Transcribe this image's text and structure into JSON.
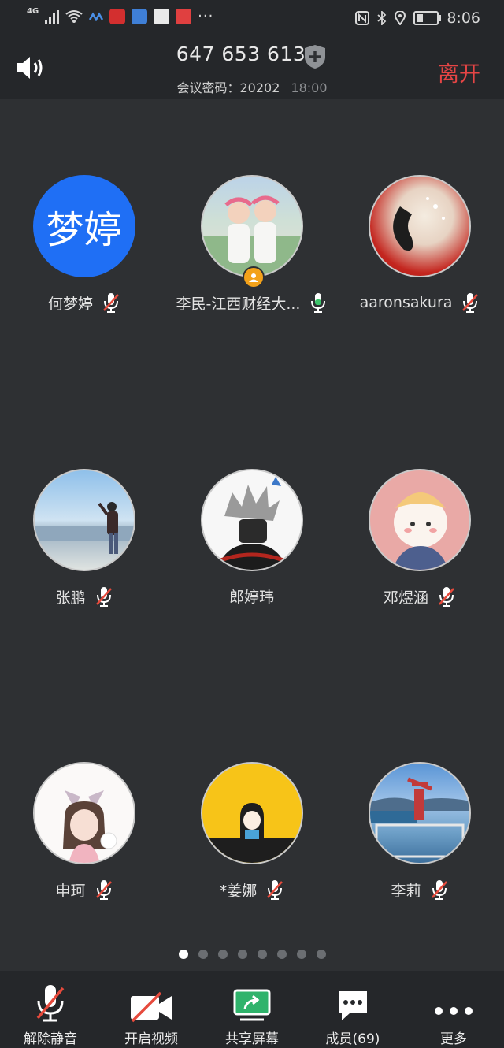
{
  "status_bar": {
    "network": "4G",
    "time": "8:06",
    "apps": [
      {
        "name": "app-icon-1",
        "color": "#d32f2f"
      },
      {
        "name": "app-icon-2",
        "color": "#3f7fd6"
      },
      {
        "name": "app-icon-3",
        "color": "#e9e9e9"
      },
      {
        "name": "app-icon-4",
        "color": "#e04040"
      }
    ],
    "more": "···"
  },
  "header": {
    "meeting_id": "647 653 613",
    "password_label": "会议密码：20202",
    "time": "18:00",
    "leave_label": "离开"
  },
  "participants": [
    {
      "name": "何梦婷",
      "avatar_text": "梦婷",
      "mic": "muted"
    },
    {
      "name": "李民-江西财经大...",
      "mic": "on",
      "host": true
    },
    {
      "name": "aaronsakura",
      "mic": "muted"
    },
    {
      "name": "张鹏",
      "mic": "muted"
    },
    {
      "name": "郎婷玮",
      "mic": "none"
    },
    {
      "name": "邓煜涵",
      "mic": "muted"
    },
    {
      "name": "申珂",
      "mic": "muted"
    },
    {
      "name": "*姜娜",
      "mic": "muted"
    },
    {
      "name": "李莉",
      "mic": "muted"
    }
  ],
  "pager": {
    "pages": 8,
    "current": 1
  },
  "toolbar": {
    "unmute_label": "解除静音",
    "video_label": "开启视频",
    "share_label": "共享屏幕",
    "members_label": "成员(69)",
    "more_label": "更多"
  },
  "colors": {
    "accent_blue": "#1f6ff5",
    "leave_red": "#e54545",
    "share_green": "#2fb36b",
    "mic_green": "#3cc46b",
    "muted_red": "#e64a3c"
  }
}
